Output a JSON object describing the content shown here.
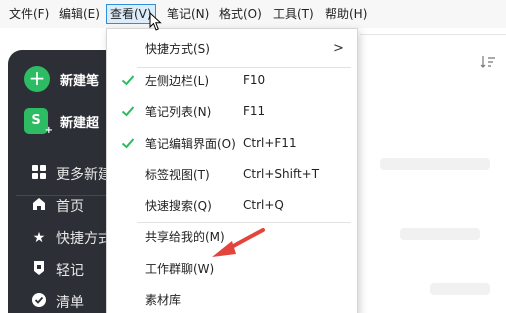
{
  "menubar": {
    "items": [
      {
        "label": "文件(F)"
      },
      {
        "label": "编辑(E)"
      },
      {
        "label": "查看(V)"
      },
      {
        "label": "笔记(N)"
      },
      {
        "label": "格式(O)"
      },
      {
        "label": "工具(T)"
      },
      {
        "label": "帮助(H)"
      }
    ]
  },
  "sidebar": {
    "new_note": "新建笔",
    "new_super": "新建超",
    "super_icon_letter": "S",
    "nav": [
      {
        "label": "更多新建",
        "icon": "grid-icon"
      },
      {
        "label": "首页",
        "icon": "home-icon"
      },
      {
        "label": "快捷方式",
        "icon": "star-icon"
      },
      {
        "label": "轻记",
        "icon": "note-icon"
      },
      {
        "label": "清单",
        "icon": "check-circle-icon"
      }
    ]
  },
  "dropdown": {
    "items": [
      {
        "label": "快捷方式(S)",
        "shortcut": "",
        "checked": false,
        "submenu": true
      },
      {
        "label": "左侧边栏(L)",
        "shortcut": "F10",
        "checked": true
      },
      {
        "label": "笔记列表(N)",
        "shortcut": "F11",
        "checked": true
      },
      {
        "label": "笔记编辑界面(O)",
        "shortcut": "Ctrl+F11",
        "checked": true
      },
      {
        "label": "标签视图(T)",
        "shortcut": "Ctrl+Shift+T",
        "checked": false
      },
      {
        "label": "快速搜索(Q)",
        "shortcut": "Ctrl+Q",
        "checked": false
      },
      {
        "label": "共享给我的(M)",
        "shortcut": "",
        "checked": false
      },
      {
        "label": "工作群聊(W)",
        "shortcut": "",
        "checked": false
      },
      {
        "label": "素材库",
        "shortcut": "",
        "checked": false
      }
    ],
    "submenu_arrow": ">"
  },
  "colors": {
    "accent_green": "#2dbb63",
    "sidebar_bg": "#2c2f35",
    "annotation_red": "#e2453c",
    "menu_active_border": "#2f8fd8"
  },
  "content": {
    "sort_icon": "sort-icon"
  }
}
